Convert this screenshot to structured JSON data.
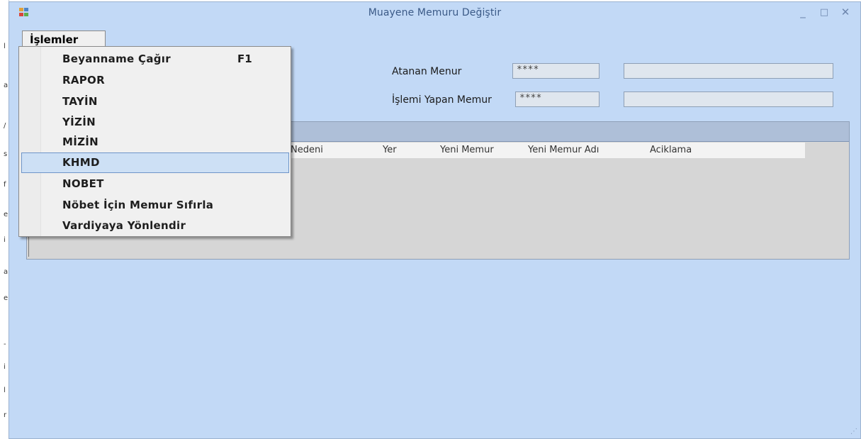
{
  "window": {
    "title": "Muayene Memuru Değiştir",
    "controls": {
      "minimize": "_",
      "maximize": "□",
      "close": "✕"
    }
  },
  "menu": {
    "top_label": "İşlemler",
    "items": [
      {
        "label": "Beyanname Çağır",
        "shortcut": "F1"
      },
      {
        "label": "RAPOR"
      },
      {
        "label": "TAYİN"
      },
      {
        "label": "YİZİN"
      },
      {
        "label": "MİZİN"
      },
      {
        "label": "KHMD",
        "highlighted": true
      },
      {
        "label": "NOBET"
      },
      {
        "label": "Nöbet İçin Memur Sıfırla"
      },
      {
        "label": "Vardiyaya Yönlendir"
      }
    ]
  },
  "form": {
    "atanan_memur": {
      "label": "Atanan Menur",
      "code": "****",
      "name": ""
    },
    "islemi_yapan_memur": {
      "label": "İşlemi Yapan Memur",
      "code": "****",
      "name": ""
    }
  },
  "grid": {
    "columns": [
      "Nedeni",
      "Yer",
      "Yeni Memur",
      "Yeni Memur Adı",
      "Aciklama"
    ]
  },
  "colors": {
    "window_bg": "#c2d9f6",
    "title_text": "#3b5a87",
    "highlight": "#cde0f5"
  }
}
